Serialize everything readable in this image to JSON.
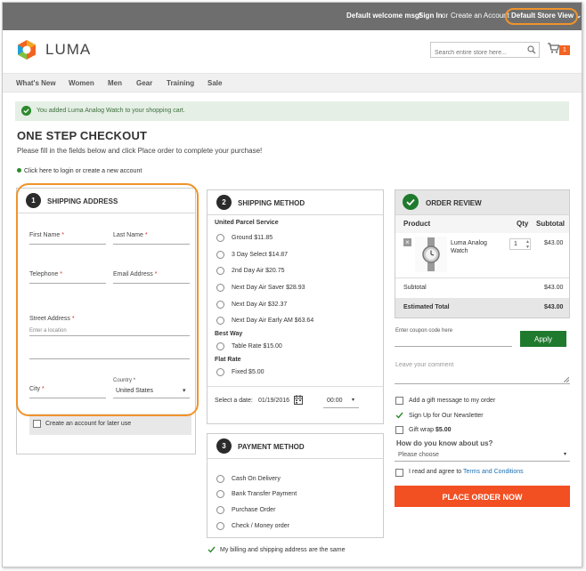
{
  "topbar": {
    "welcome": "Default welcome msg!",
    "sign_in": "Sign In",
    "or": "or",
    "create_account": "Create an Account",
    "store_view": "Default Store View"
  },
  "header": {
    "logo_text": "LUMA",
    "search_placeholder": "Search entire store here...",
    "cart_count": "1"
  },
  "nav": {
    "items": [
      "What's New",
      "Women",
      "Men",
      "Gear",
      "Training",
      "Sale"
    ]
  },
  "message": {
    "success": "You added Luma Analog Watch to your shopping cart."
  },
  "page": {
    "title": "ONE STEP CHECKOUT",
    "subtitle": "Please fill in the fields below and click Place order to complete your purchase!",
    "login_link": "Click here to login or create a new account"
  },
  "shipping_address": {
    "step": "1",
    "title": "SHIPPING ADDRESS",
    "first_name": "First Name",
    "last_name": "Last Name",
    "telephone": "Telephone",
    "email": "Email Address",
    "street": "Street Address",
    "street_placeholder": "Enter a location",
    "city": "City",
    "country_label": "Country",
    "country_value": "United States",
    "req": "*",
    "create_account": "Create an account for later use"
  },
  "shipping_method": {
    "step": "2",
    "title": "SHIPPING METHOD",
    "groups": [
      {
        "label": "United Parcel Service",
        "options": [
          "Ground $11.85",
          "3 Day Select $14.87",
          "2nd Day Air $20.75",
          "Next Day Air Saver $28.93",
          "Next Day Air $32.37",
          "Next Day Air Early AM $63.64"
        ]
      },
      {
        "label": "Best Way",
        "options": [
          "Table Rate $15.00"
        ]
      },
      {
        "label": "Flat Rate",
        "options": [
          "Fixed $5.00"
        ]
      }
    ],
    "date_label": "Select a date:",
    "date_value": "01/19/2016",
    "time_value": "00:00"
  },
  "payment_method": {
    "step": "3",
    "title": "PAYMENT METHOD",
    "options": [
      "Cash On Delivery",
      "Bank Transfer Payment",
      "Purchase Order",
      "Check / Money order"
    ],
    "billing_same": "My billing and shipping address are the same"
  },
  "order_review": {
    "title": "ORDER REVIEW",
    "col_product": "Product",
    "col_qty": "Qty",
    "col_subtotal": "Subtotal",
    "item_name": "Luma Analog Watch",
    "item_qty": "1",
    "item_subtotal": "$43.00",
    "remove": "×",
    "subtotal_label": "Subtotal",
    "subtotal_value": "$43.00",
    "total_label": "Estimated Total",
    "total_value": "$43.00",
    "coupon_placeholder": "Enter coupon code here",
    "apply": "Apply",
    "comment_placeholder": "Leave your comment",
    "gift_message": "Add a gift message to my order",
    "newsletter": "Sign Up for Our Newsletter",
    "gift_wrap": "Gift wrap",
    "gift_wrap_price": "$5.00",
    "how_know": "How do you know about us?",
    "please_choose": "Please choose",
    "agree": "I read and agree to",
    "terms": "Terms and Conditions",
    "place_order": "PLACE ORDER NOW"
  },
  "colors": {
    "accent_orange": "#f26322",
    "ring_orange": "#f0932b",
    "green": "#1f7a2e",
    "place_order": "#f24f22"
  }
}
